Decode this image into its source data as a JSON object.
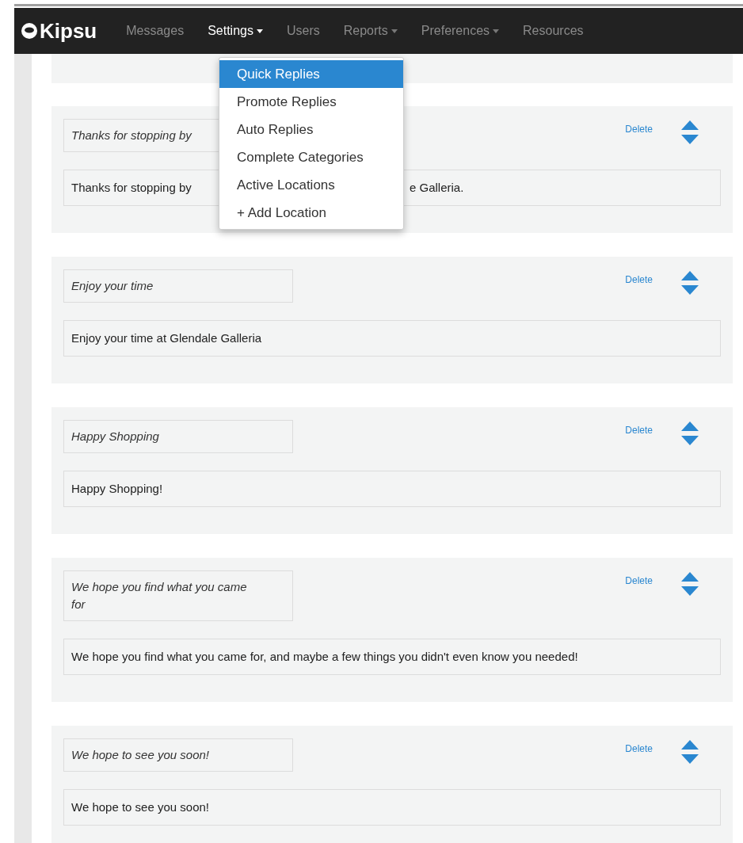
{
  "brand": "Kipsu",
  "nav": [
    {
      "label": "Messages",
      "selected": false,
      "dropdown": false
    },
    {
      "label": "Settings",
      "selected": true,
      "dropdown": true
    },
    {
      "label": "Users",
      "selected": false,
      "dropdown": false
    },
    {
      "label": "Reports",
      "selected": false,
      "dropdown": true
    },
    {
      "label": "Preferences",
      "selected": false,
      "dropdown": true
    },
    {
      "label": "Resources",
      "selected": false,
      "dropdown": false
    }
  ],
  "menu": [
    {
      "label": "Quick Replies",
      "selected": true
    },
    {
      "label": "Promote Replies",
      "selected": false
    },
    {
      "label": "Auto Replies",
      "selected": false
    },
    {
      "label": "Complete Categories",
      "selected": false
    },
    {
      "label": "Active Locations",
      "selected": false
    },
    {
      "label": "+ Add Location",
      "selected": false
    }
  ],
  "replies": [
    {
      "title": "Thanks for stopping by",
      "body": [
        "Thanks for stopping by",
        "e Galleria."
      ],
      "delete": "Delete"
    },
    {
      "title": "Enjoy your time",
      "body": [
        "Enjoy your time at Glendale Galleria"
      ],
      "delete": "Delete"
    },
    {
      "title": "Happy Shopping",
      "body": [
        "Happy Shopping!"
      ],
      "delete": "Delete"
    },
    {
      "title": "We hope you find what you came for",
      "body": [
        "We hope you find what you came for, and maybe a few things you didn't even know you needed!"
      ],
      "delete": "Delete"
    },
    {
      "title": "We hope to see you soon!",
      "body": [
        "We hope to see you soon!"
      ],
      "delete": "Delete"
    }
  ]
}
